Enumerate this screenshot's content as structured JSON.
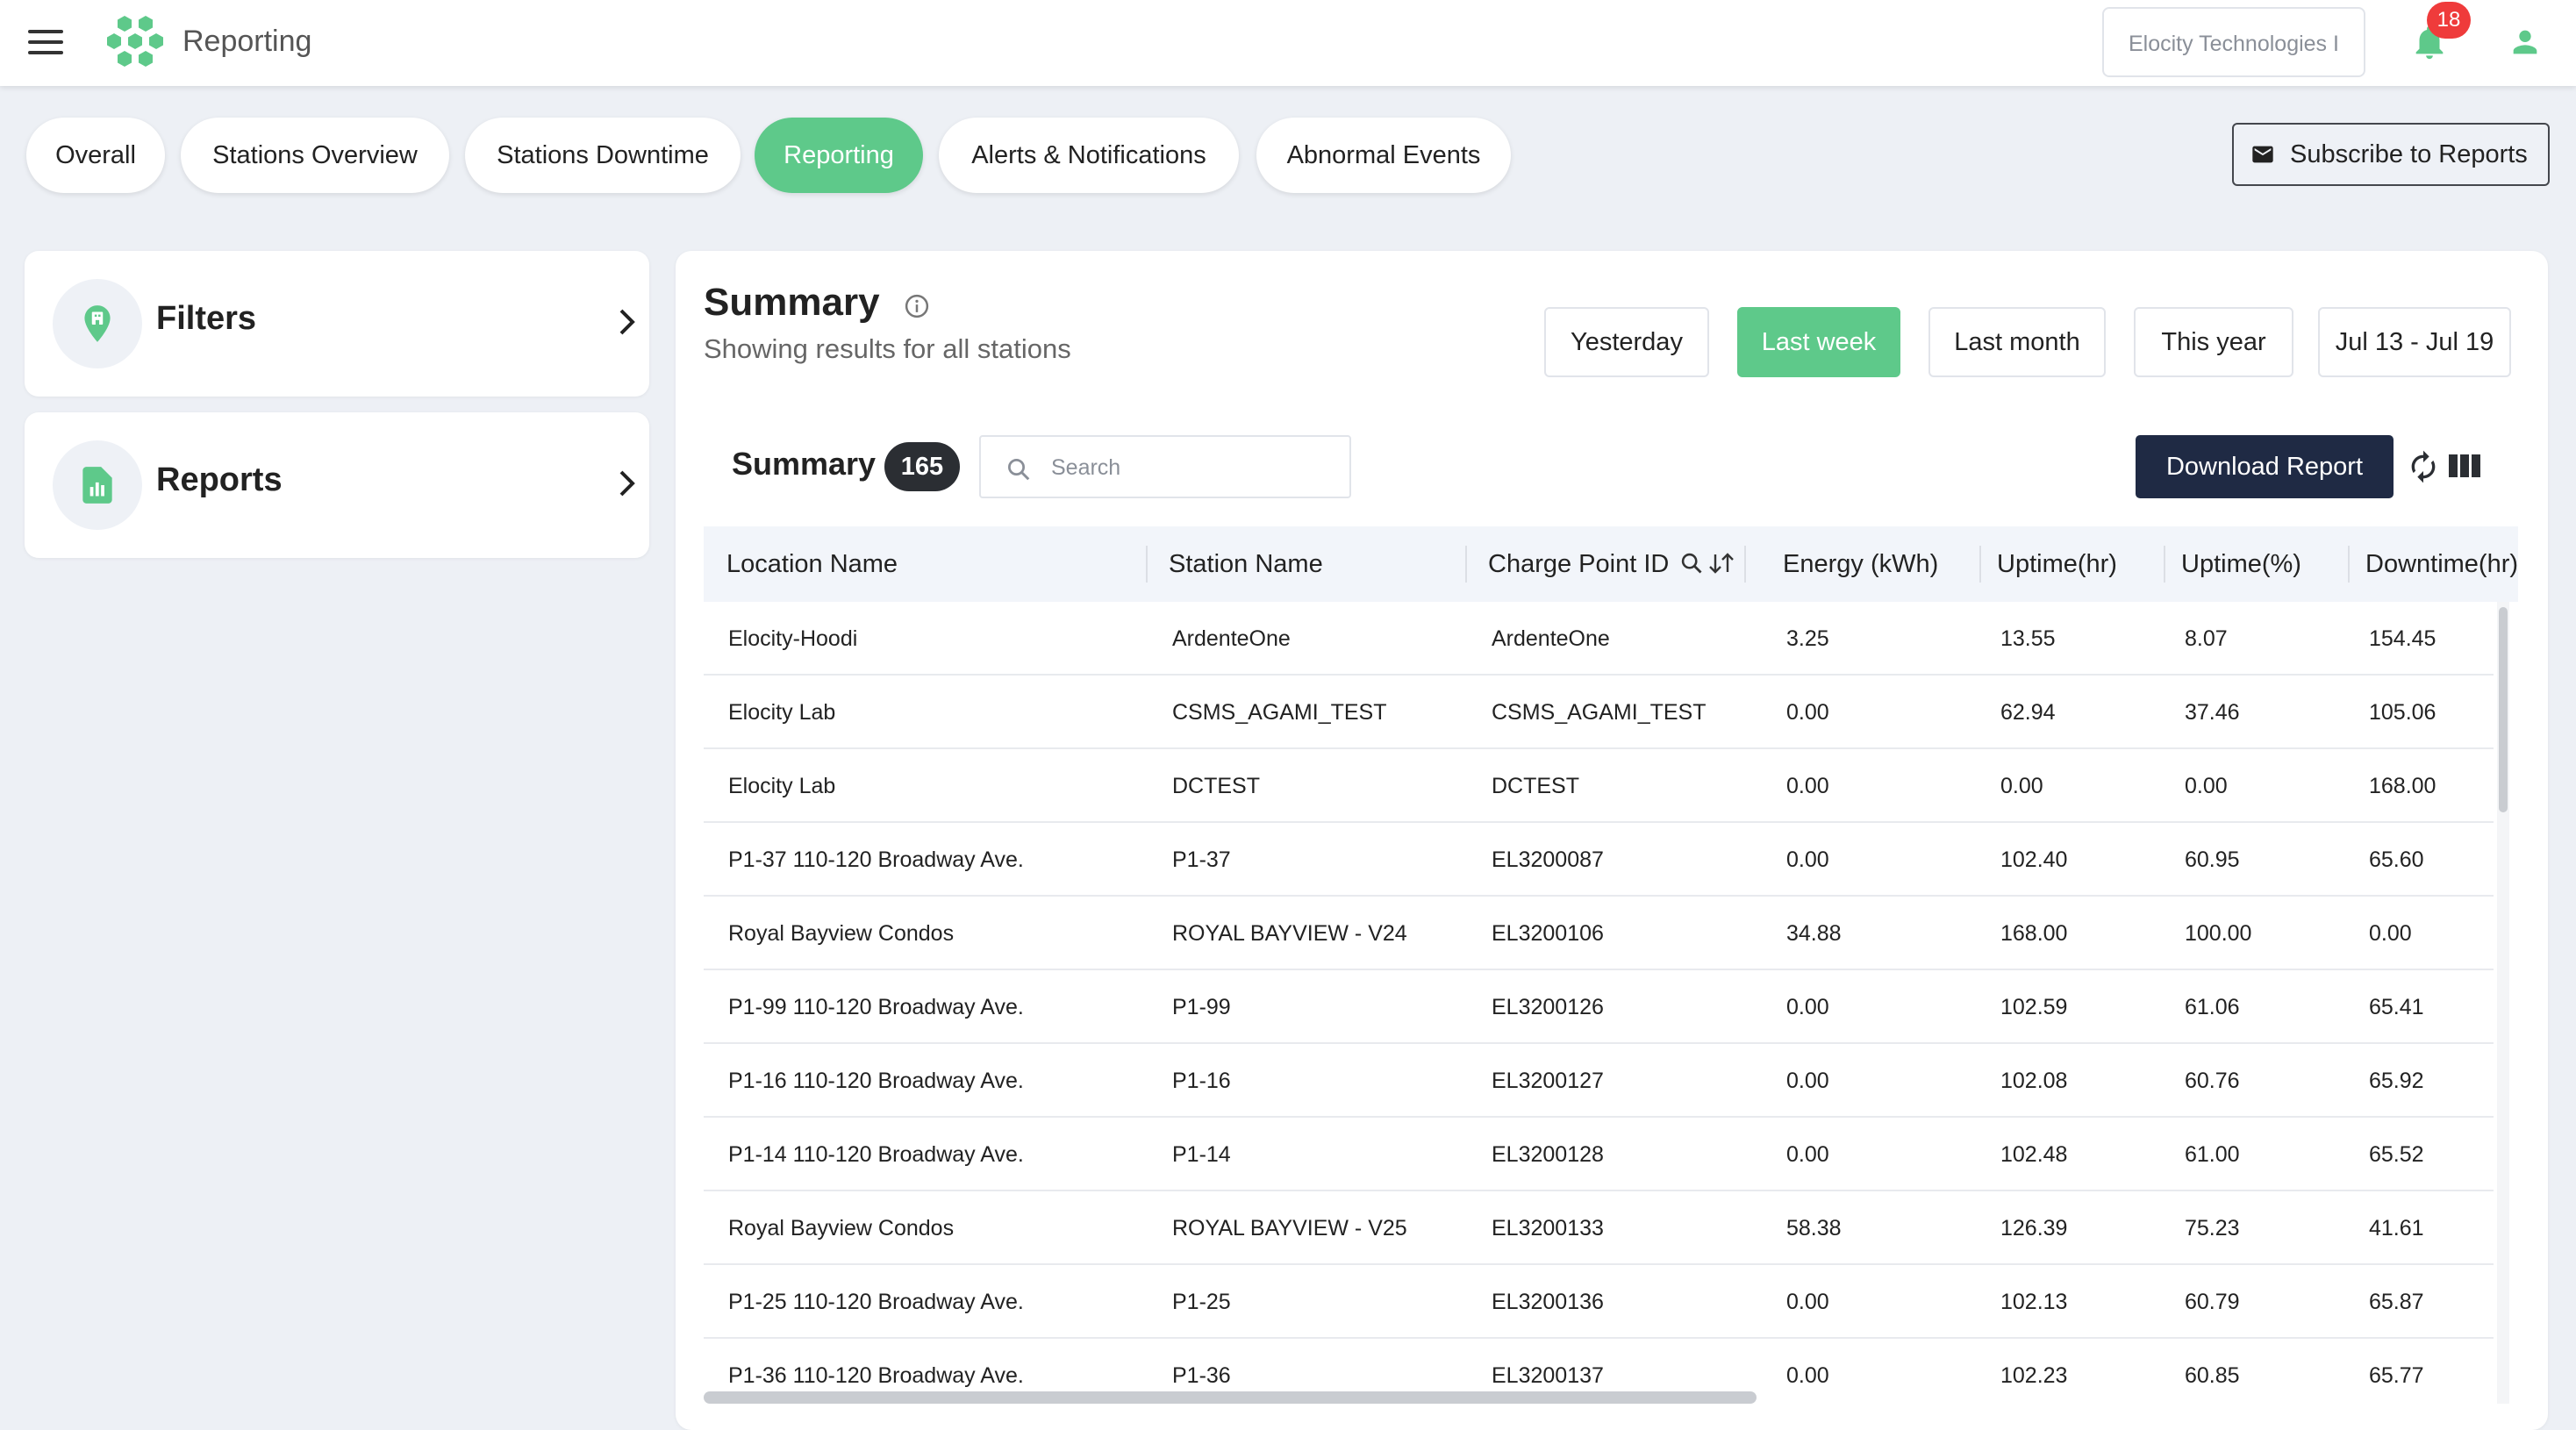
{
  "app": {
    "title": "Reporting",
    "company": "Elocity Technologies I",
    "notification_count": "18"
  },
  "tabs": [
    {
      "label": "Overall"
    },
    {
      "label": "Stations Overview"
    },
    {
      "label": "Stations Downtime"
    },
    {
      "label": "Reporting",
      "active": true
    },
    {
      "label": "Alerts & Notifications"
    },
    {
      "label": "Abnormal Events"
    }
  ],
  "subscribe_label": "Subscribe to Reports",
  "sidebar": {
    "filters_label": "Filters",
    "reports_label": "Reports"
  },
  "summary": {
    "title": "Summary",
    "subtitle": "Showing results for all stations",
    "ranges": [
      {
        "label": "Yesterday"
      },
      {
        "label": "Last week",
        "active": true
      },
      {
        "label": "Last month"
      },
      {
        "label": "This year"
      },
      {
        "label": "Jul 13 - Jul 19"
      }
    ]
  },
  "table": {
    "title": "Summary",
    "count": "165",
    "search_placeholder": "Search",
    "download_label": "Download Report",
    "columns": [
      "Location Name",
      "Station Name",
      "Charge Point ID",
      "Energy (kWh)",
      "Uptime(hr)",
      "Uptime(%)",
      "Downtime(hr)"
    ],
    "rows": [
      [
        "Elocity-Hoodi",
        "ArdenteOne",
        "ArdenteOne",
        "3.25",
        "13.55",
        "8.07",
        "154.45"
      ],
      [
        "Elocity Lab",
        "CSMS_AGAMI_TEST",
        "CSMS_AGAMI_TEST",
        "0.00",
        "62.94",
        "37.46",
        "105.06"
      ],
      [
        "Elocity Lab",
        "DCTEST",
        "DCTEST",
        "0.00",
        "0.00",
        "0.00",
        "168.00"
      ],
      [
        "P1-37 110-120 Broadway Ave.",
        "P1-37",
        "EL3200087",
        "0.00",
        "102.40",
        "60.95",
        "65.60"
      ],
      [
        "Royal Bayview Condos",
        "ROYAL BAYVIEW - V24",
        "EL3200106",
        "34.88",
        "168.00",
        "100.00",
        "0.00"
      ],
      [
        "P1-99 110-120 Broadway Ave.",
        "P1-99",
        "EL3200126",
        "0.00",
        "102.59",
        "61.06",
        "65.41"
      ],
      [
        "P1-16 110-120 Broadway Ave.",
        "P1-16",
        "EL3200127",
        "0.00",
        "102.08",
        "60.76",
        "65.92"
      ],
      [
        "P1-14 110-120 Broadway Ave.",
        "P1-14",
        "EL3200128",
        "0.00",
        "102.48",
        "61.00",
        "65.52"
      ],
      [
        "Royal Bayview Condos",
        "ROYAL BAYVIEW - V25",
        "EL3200133",
        "58.38",
        "126.39",
        "75.23",
        "41.61"
      ],
      [
        "P1-25 110-120 Broadway Ave.",
        "P1-25",
        "EL3200136",
        "0.00",
        "102.13",
        "60.79",
        "65.87"
      ],
      [
        "P1-36 110-120 Broadway Ave.",
        "P1-36",
        "EL3200137",
        "0.00",
        "102.23",
        "60.85",
        "65.77"
      ]
    ]
  },
  "colors": {
    "accent": "#5ec98a",
    "dark_button": "#1f2a44",
    "badge_red": "#ef3b3b"
  },
  "icons": {
    "menu": "menu-icon",
    "logo": "hexagon-cluster-logo",
    "bell": "bell-icon",
    "user": "user-icon",
    "subscribe": "mail-icon",
    "filters": "map-pin-icon",
    "reports": "report-chart-icon",
    "info": "info-icon",
    "search": "search-icon",
    "refresh": "refresh-icon",
    "columns": "columns-icon",
    "sort": "sort-icon"
  }
}
